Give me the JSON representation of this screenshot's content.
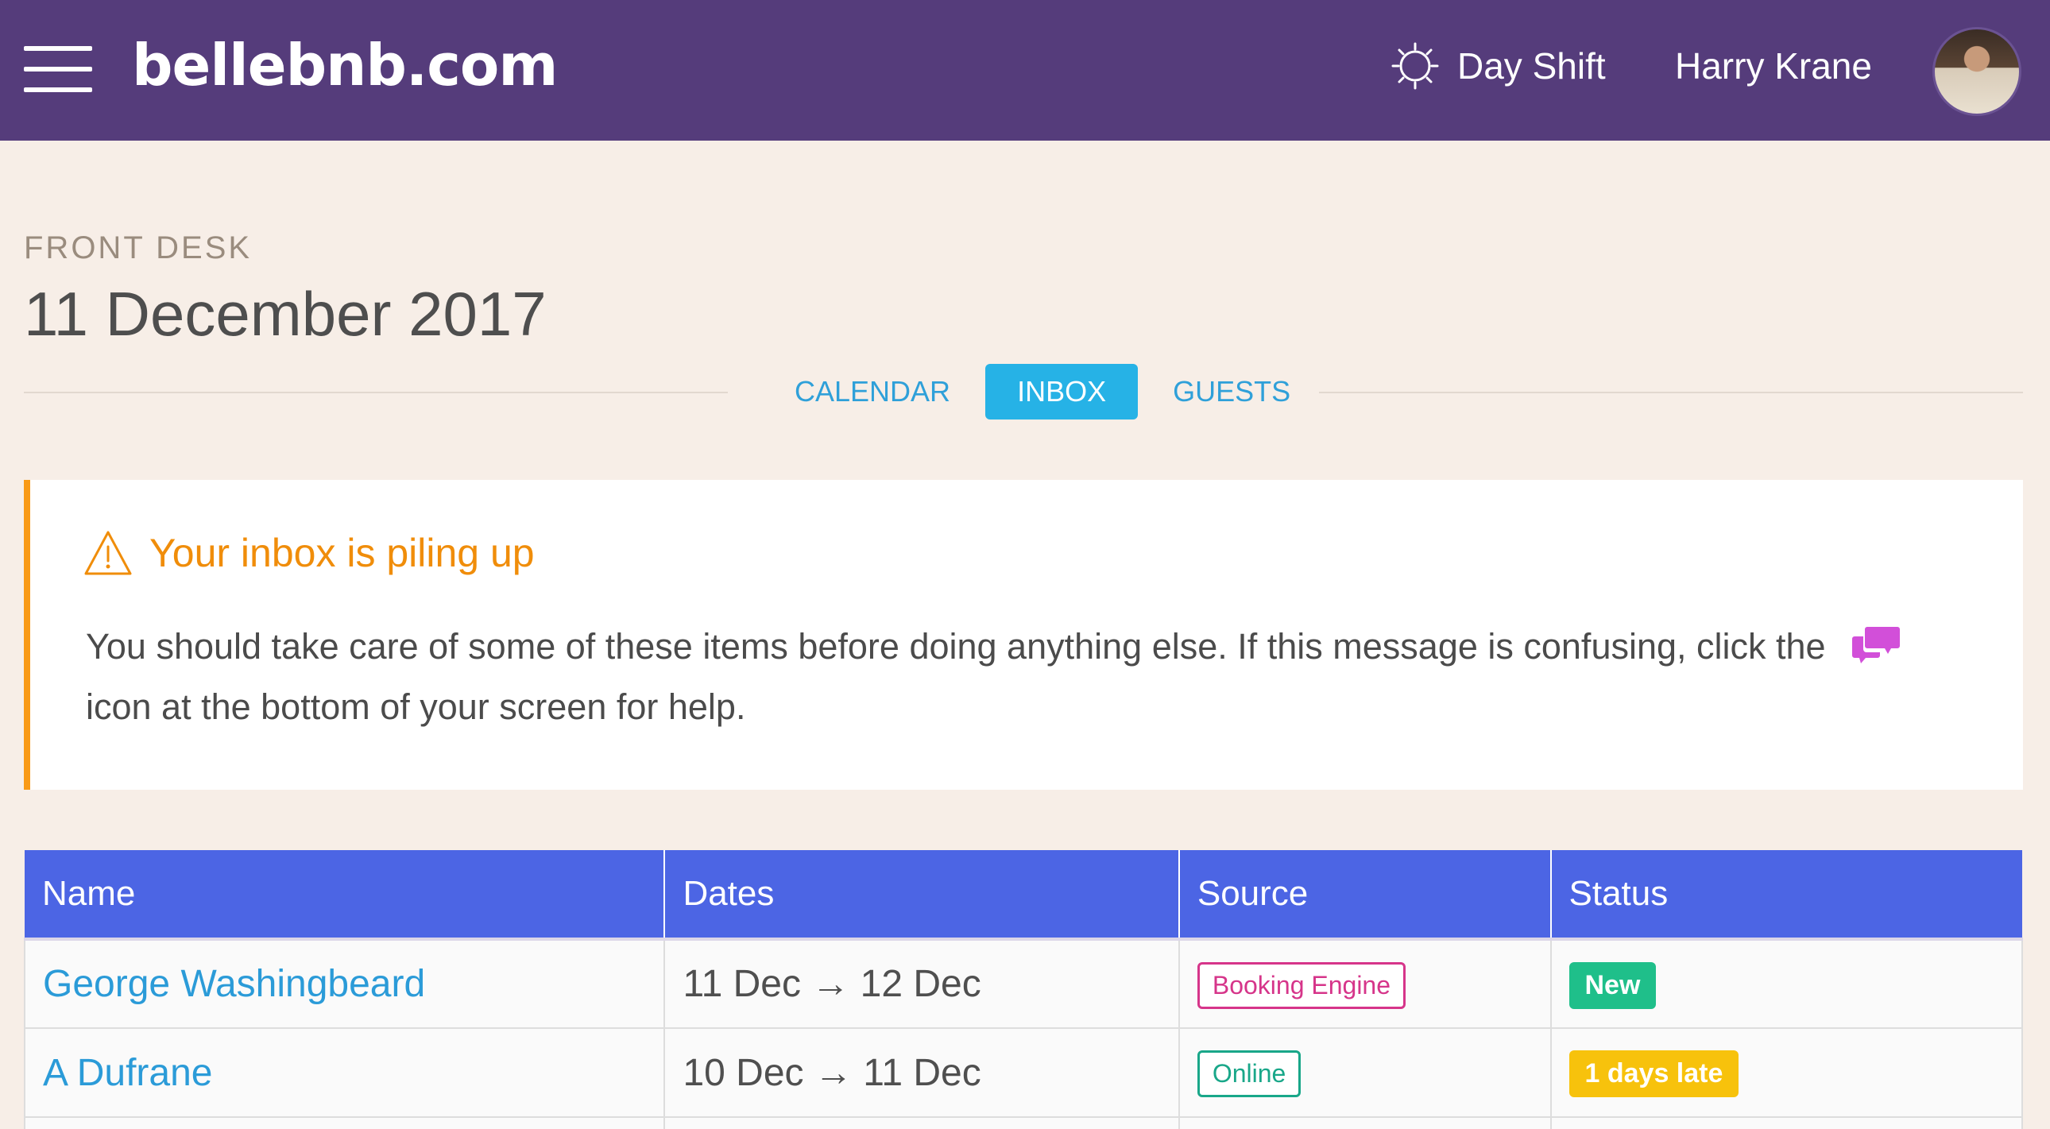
{
  "header": {
    "logo": "bellebnb.com",
    "shift_label": "Day Shift",
    "user_name": "Harry Krane"
  },
  "page": {
    "section_label": "FRONT DESK",
    "title": "11 December 2017"
  },
  "tabs": [
    {
      "label": "CALENDAR",
      "active": false
    },
    {
      "label": "INBOX",
      "active": true
    },
    {
      "label": "GUESTS",
      "active": false
    }
  ],
  "alert": {
    "title": "Your inbox is piling up",
    "text_before_icon": "You should take care of some of these items before doing anything else. If this message is confusing, click the",
    "text_after_icon": "icon at the bottom of your screen for help."
  },
  "table": {
    "columns": [
      "Name",
      "Dates",
      "Source",
      "Status"
    ],
    "rows": [
      {
        "name": "George Washingbeard",
        "dates": "11 Dec → 12 Dec",
        "source": "Booking Engine",
        "source_color": "#d6358a",
        "status": "New",
        "status_color": "#1fbf8a"
      },
      {
        "name": "A Dufrane",
        "dates": "10 Dec → 11 Dec",
        "source": "Online",
        "source_color": "#19a789",
        "status": "1 days late",
        "status_color": "#f7c20c"
      }
    ]
  },
  "colors": {
    "topbar": "#553c7b",
    "background": "#f7eee7",
    "accent": "#26b2e6",
    "warning": "#f99a16",
    "table_header": "#4c65e4",
    "chat_icon": "#d24fd9"
  }
}
